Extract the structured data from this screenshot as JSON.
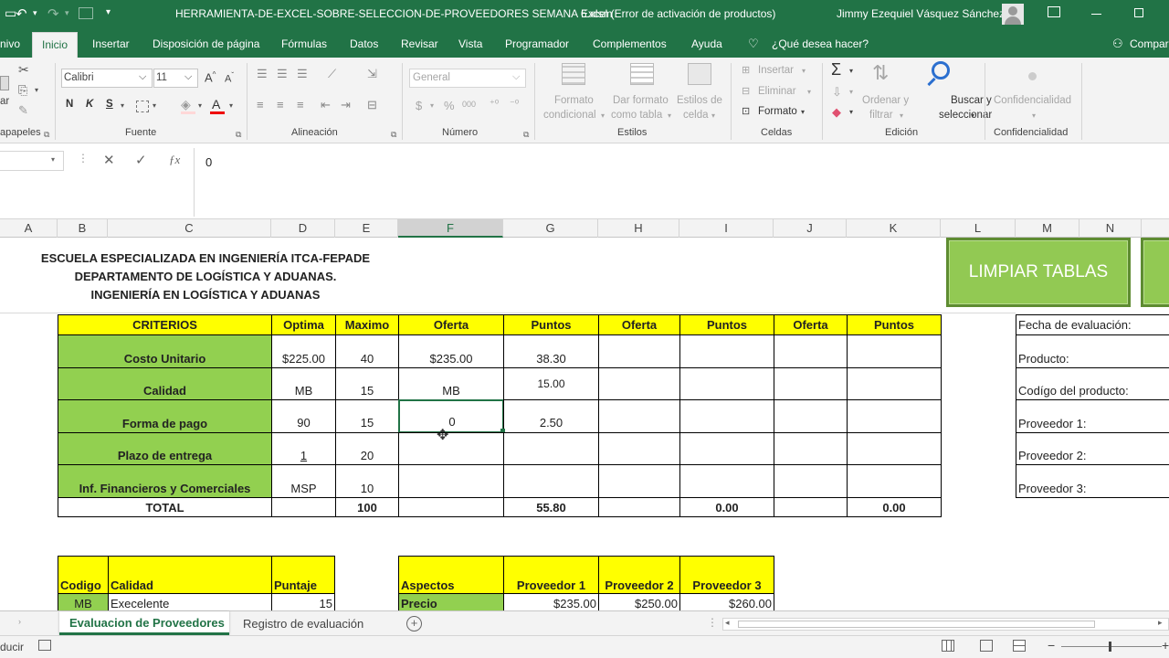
{
  "titlebar": {
    "filename": "HERRAMIENTA-DE-EXCEL-SOBRE-SELECCION-DE-PROVEEDORES SEMANA 6.xlsm",
    "app_status": "Excel (Error de activación de productos)",
    "user": "Jimmy Ezequiel Vásquez Sánchez"
  },
  "tabs": [
    "nivo",
    "Inicio",
    "Insertar",
    "Disposición de página",
    "Fórmulas",
    "Datos",
    "Revisar",
    "Vista",
    "Programador",
    "Complementos",
    "Ayuda"
  ],
  "tell_me": "¿Qué desea hacer?",
  "share": "Compar",
  "ribbon": {
    "paste_label": "ar",
    "clipboard_group": "apapeles",
    "font_name": "Calibri",
    "font_size": "11",
    "bold": "N",
    "italic": "K",
    "underline": "S",
    "font_group": "Fuente",
    "align_group": "Alineación",
    "number_format": "General",
    "currency": "$",
    "percent": "%",
    "thousands": "000",
    "number_group": "Número",
    "cond_format": [
      "Formato",
      "condicional"
    ],
    "format_table": [
      "Dar formato",
      "como tabla"
    ],
    "cell_styles": [
      "Estilos de",
      "celda"
    ],
    "styles_group": "Estilos",
    "insert": "Insertar",
    "delete": "Eliminar",
    "format": "Formato",
    "cells_group": "Celdas",
    "sort_filter": [
      "Ordenar y",
      "filtrar"
    ],
    "find_select": [
      "Buscar y",
      "seleccionar"
    ],
    "edit_group": "Edición",
    "confidential": "Confidencialidad",
    "confidential_group": "Confidencialidad"
  },
  "formula_bar": {
    "value": "0"
  },
  "columns": [
    "A",
    "B",
    "C",
    "D",
    "E",
    "F",
    "G",
    "H",
    "I",
    "J",
    "K",
    "L",
    "M",
    "N"
  ],
  "selected_column": "F",
  "header_lines": [
    "ESCUELA ESPECIALIZADA EN INGENIERÍA ITCA-FEPADE",
    "DEPARTAMENTO DE LOGÍSTICA Y ADUANAS.",
    "INGENIERÍA EN LOGÍSTICA Y ADUANAS"
  ],
  "buttons": {
    "clear_tables": "LIMPIAR TABLAS"
  },
  "eval_table": {
    "headers": [
      "CRITERIOS",
      "Optima",
      "Maximo",
      "Oferta",
      "Puntos",
      "Oferta",
      "Puntos",
      "Oferta",
      "Puntos"
    ],
    "rows": [
      [
        "Costo Unitario",
        "$225.00",
        "40",
        "$235.00",
        "38.30",
        "",
        "",
        "",
        ""
      ],
      [
        "Calidad",
        "MB",
        "15",
        "MB",
        "15.00",
        "",
        "",
        "",
        ""
      ],
      [
        "Forma de pago",
        "90",
        "15",
        "0",
        "2.50",
        "",
        "",
        "",
        ""
      ],
      [
        "Plazo de entrega",
        "1",
        "20",
        "",
        "",
        "",
        "",
        "",
        ""
      ],
      [
        "Inf. Financieros y Comerciales",
        "MSP",
        "10",
        "",
        "",
        "",
        "",
        "",
        ""
      ]
    ],
    "total": [
      "TOTAL",
      "",
      "100",
      "",
      "55.80",
      "",
      "0.00",
      "",
      "0.00"
    ]
  },
  "info_labels": [
    "Fecha de evaluación:",
    "Producto:",
    "Codígo del producto:",
    "Proveedor 1:",
    "Proveedor 2:",
    "Proveedor 3:"
  ],
  "quality_table": {
    "headers": [
      "Codigo",
      "Calidad",
      "Puntaje"
    ],
    "row": [
      "MB",
      "Execelente",
      "15"
    ]
  },
  "aspects_table": {
    "headers": [
      "Aspectos",
      "Proveedor 1",
      "Proveedor 2",
      "Proveedor 3"
    ],
    "row": [
      "Precio",
      "$235.00",
      "$250.00",
      "$260.00"
    ]
  },
  "sheets": [
    "Evaluacion de Proveedores",
    "Registro de evaluación"
  ],
  "status": "ducir",
  "colors": {
    "excel_green": "#217346",
    "header_yellow": "#ffff00",
    "criteria_green": "#92d050",
    "button_green": "#92c953"
  }
}
